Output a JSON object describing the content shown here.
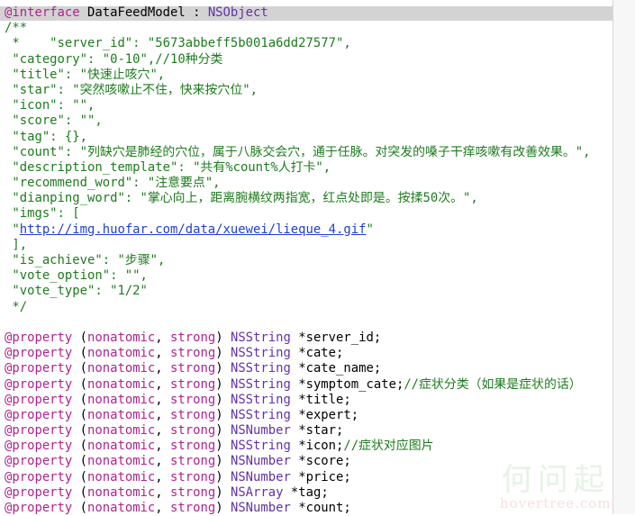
{
  "code_lines": [
    [
      {
        "t": "@interface",
        "c": "kw"
      },
      {
        "t": " DataFeedModel : ",
        "c": "pl"
      },
      {
        "t": "NSObject",
        "c": "cls"
      }
    ],
    [
      {
        "t": "/**",
        "c": "cm"
      }
    ],
    [
      {
        "t": " *    \"server_id\": \"5673abbeff5b001a6dd27577\",",
        "c": "cm"
      }
    ],
    [
      {
        "t": " \"category\": \"0-10\",//10种分类",
        "c": "cm"
      }
    ],
    [
      {
        "t": " \"title\": \"快速止咳穴\",",
        "c": "cm"
      }
    ],
    [
      {
        "t": " \"star\": \"突然咳嗽止不住，快来按穴位\",",
        "c": "cm"
      }
    ],
    [
      {
        "t": " \"icon\": \"\",",
        "c": "cm"
      }
    ],
    [
      {
        "t": " \"score\": \"\",",
        "c": "cm"
      }
    ],
    [
      {
        "t": " \"tag\": {},",
        "c": "cm"
      }
    ],
    [
      {
        "t": " \"count\": \"列缺穴是肺经的穴位，属于八脉交会穴，通于任脉。对突发的嗓子干痒咳嗽有改善效果。\",",
        "c": "cm"
      }
    ],
    [
      {
        "t": " \"description_template\": \"共有%count%人打卡\",",
        "c": "cm"
      }
    ],
    [
      {
        "t": " \"recommend_word\": \"注意要点\",",
        "c": "cm"
      }
    ],
    [
      {
        "t": " \"dianping_word\": \"掌心向上，距离腕横纹两指宽，红点处即是。按揉50次。\",",
        "c": "cm"
      }
    ],
    [
      {
        "t": " \"imgs\": [",
        "c": "cm"
      }
    ],
    [
      {
        "t": " \"",
        "c": "cm"
      },
      {
        "t": "http://img.huofar.com/data/xuewei/lieque_4.gif",
        "c": "url"
      },
      {
        "t": "\"",
        "c": "cm"
      }
    ],
    [
      {
        "t": " ],",
        "c": "cm"
      }
    ],
    [
      {
        "t": " \"is_achieve\": \"步骤\",",
        "c": "cm"
      }
    ],
    [
      {
        "t": " \"vote_option\": \"\",",
        "c": "cm"
      }
    ],
    [
      {
        "t": " \"vote_type\": \"1/2\"",
        "c": "cm"
      }
    ],
    [
      {
        "t": " */",
        "c": "cm"
      }
    ],
    [],
    [
      {
        "t": "@property",
        "c": "kw"
      },
      {
        "t": " (",
        "c": "pl"
      },
      {
        "t": "nonatomic",
        "c": "kw"
      },
      {
        "t": ", ",
        "c": "pl"
      },
      {
        "t": "strong",
        "c": "kw"
      },
      {
        "t": ") ",
        "c": "pl"
      },
      {
        "t": "NSString",
        "c": "cls"
      },
      {
        "t": " *server_id;",
        "c": "pl"
      }
    ],
    [
      {
        "t": "@property",
        "c": "kw"
      },
      {
        "t": " (",
        "c": "pl"
      },
      {
        "t": "nonatomic",
        "c": "kw"
      },
      {
        "t": ", ",
        "c": "pl"
      },
      {
        "t": "strong",
        "c": "kw"
      },
      {
        "t": ") ",
        "c": "pl"
      },
      {
        "t": "NSString",
        "c": "cls"
      },
      {
        "t": " *cate;",
        "c": "pl"
      }
    ],
    [
      {
        "t": "@property",
        "c": "kw"
      },
      {
        "t": " (",
        "c": "pl"
      },
      {
        "t": "nonatomic",
        "c": "kw"
      },
      {
        "t": ", ",
        "c": "pl"
      },
      {
        "t": "strong",
        "c": "kw"
      },
      {
        "t": ") ",
        "c": "pl"
      },
      {
        "t": "NSString",
        "c": "cls"
      },
      {
        "t": " *cate_name;",
        "c": "pl"
      }
    ],
    [
      {
        "t": "@property",
        "c": "kw"
      },
      {
        "t": " (",
        "c": "pl"
      },
      {
        "t": "nonatomic",
        "c": "kw"
      },
      {
        "t": ", ",
        "c": "pl"
      },
      {
        "t": "strong",
        "c": "kw"
      },
      {
        "t": ") ",
        "c": "pl"
      },
      {
        "t": "NSString",
        "c": "cls"
      },
      {
        "t": " *symptom_cate;",
        "c": "pl"
      },
      {
        "t": "//症状分类（如果是症状的话）",
        "c": "cm"
      }
    ],
    [
      {
        "t": "@property",
        "c": "kw"
      },
      {
        "t": " (",
        "c": "pl"
      },
      {
        "t": "nonatomic",
        "c": "kw"
      },
      {
        "t": ", ",
        "c": "pl"
      },
      {
        "t": "strong",
        "c": "kw"
      },
      {
        "t": ") ",
        "c": "pl"
      },
      {
        "t": "NSString",
        "c": "cls"
      },
      {
        "t": " *title;",
        "c": "pl"
      }
    ],
    [
      {
        "t": "@property",
        "c": "kw"
      },
      {
        "t": " (",
        "c": "pl"
      },
      {
        "t": "nonatomic",
        "c": "kw"
      },
      {
        "t": ", ",
        "c": "pl"
      },
      {
        "t": "strong",
        "c": "kw"
      },
      {
        "t": ") ",
        "c": "pl"
      },
      {
        "t": "NSString",
        "c": "cls"
      },
      {
        "t": " *expert;",
        "c": "pl"
      }
    ],
    [
      {
        "t": "@property",
        "c": "kw"
      },
      {
        "t": " (",
        "c": "pl"
      },
      {
        "t": "nonatomic",
        "c": "kw"
      },
      {
        "t": ", ",
        "c": "pl"
      },
      {
        "t": "strong",
        "c": "kw"
      },
      {
        "t": ") ",
        "c": "pl"
      },
      {
        "t": "NSNumber",
        "c": "cls"
      },
      {
        "t": " *star;",
        "c": "pl"
      }
    ],
    [
      {
        "t": "@property",
        "c": "kw"
      },
      {
        "t": " (",
        "c": "pl"
      },
      {
        "t": "nonatomic",
        "c": "kw"
      },
      {
        "t": ", ",
        "c": "pl"
      },
      {
        "t": "strong",
        "c": "kw"
      },
      {
        "t": ") ",
        "c": "pl"
      },
      {
        "t": "NSString",
        "c": "cls"
      },
      {
        "t": " *icon;",
        "c": "pl"
      },
      {
        "t": "//症状对应图片",
        "c": "cm"
      }
    ],
    [
      {
        "t": "@property",
        "c": "kw"
      },
      {
        "t": " (",
        "c": "pl"
      },
      {
        "t": "nonatomic",
        "c": "kw"
      },
      {
        "t": ", ",
        "c": "pl"
      },
      {
        "t": "strong",
        "c": "kw"
      },
      {
        "t": ") ",
        "c": "pl"
      },
      {
        "t": "NSNumber",
        "c": "cls"
      },
      {
        "t": " *score;",
        "c": "pl"
      }
    ],
    [
      {
        "t": "@property",
        "c": "kw"
      },
      {
        "t": " (",
        "c": "pl"
      },
      {
        "t": "nonatomic",
        "c": "kw"
      },
      {
        "t": ", ",
        "c": "pl"
      },
      {
        "t": "strong",
        "c": "kw"
      },
      {
        "t": ") ",
        "c": "pl"
      },
      {
        "t": "NSNumber",
        "c": "cls"
      },
      {
        "t": " *price;",
        "c": "pl"
      }
    ],
    [
      {
        "t": "@property",
        "c": "kw"
      },
      {
        "t": " (",
        "c": "pl"
      },
      {
        "t": "nonatomic",
        "c": "kw"
      },
      {
        "t": ", ",
        "c": "pl"
      },
      {
        "t": "strong",
        "c": "kw"
      },
      {
        "t": ") ",
        "c": "pl"
      },
      {
        "t": "NSArray",
        "c": "cls"
      },
      {
        "t": " *tag;",
        "c": "pl"
      }
    ],
    [
      {
        "t": "@property",
        "c": "kw"
      },
      {
        "t": " (",
        "c": "pl"
      },
      {
        "t": "nonatomic",
        "c": "kw"
      },
      {
        "t": ", ",
        "c": "pl"
      },
      {
        "t": "strong",
        "c": "kw"
      },
      {
        "t": ") ",
        "c": "pl"
      },
      {
        "t": "NSNumber",
        "c": "cls"
      },
      {
        "t": " *count;",
        "c": "pl"
      }
    ]
  ],
  "watermark": {
    "cn": "何问起",
    "en": "hovertree.com"
  }
}
